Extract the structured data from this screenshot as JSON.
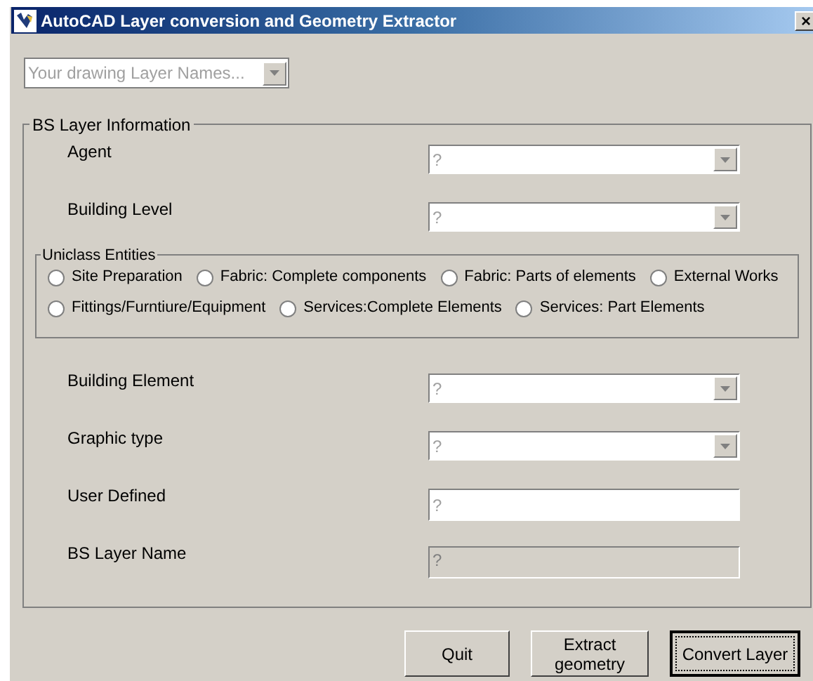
{
  "window": {
    "title": "AutoCAD Layer conversion and Geometry Extractor",
    "close": "×"
  },
  "layer_dropdown": {
    "placeholder": "Your drawing Layer Names..."
  },
  "bs_group": {
    "title": "BS Layer Information",
    "top_fields": [
      {
        "label": "Agent",
        "kind": "combo",
        "value": "?"
      },
      {
        "label": "Building Level",
        "kind": "combo",
        "value": "?"
      }
    ],
    "uniclass": {
      "title": "Uniclass Entities",
      "rows": [
        [
          {
            "label": "Site Preparation",
            "selected": false
          },
          {
            "label": "Fabric: Complete components",
            "selected": false
          },
          {
            "label": "Fabric: Parts of elements",
            "selected": false
          },
          {
            "label": "External Works",
            "selected": false
          }
        ],
        [
          {
            "label": "Fittings/Furntiure/Equipment",
            "selected": false
          },
          {
            "label": "Services:Complete Elements",
            "selected": false
          },
          {
            "label": "Services: Part Elements",
            "selected": false
          }
        ]
      ]
    },
    "bottom_fields": [
      {
        "label": "Building Element",
        "kind": "combo",
        "value": "?"
      },
      {
        "label": "Graphic type",
        "kind": "combo",
        "value": "?"
      },
      {
        "label": "User Defined",
        "kind": "text",
        "value": "?"
      },
      {
        "label": "BS Layer Name",
        "kind": "readonly",
        "value": "?"
      }
    ]
  },
  "buttons": [
    {
      "label": "Quit",
      "default": false
    },
    {
      "label": "Extract geometry",
      "default": false
    },
    {
      "label": "Convert Layer",
      "default": true
    }
  ]
}
